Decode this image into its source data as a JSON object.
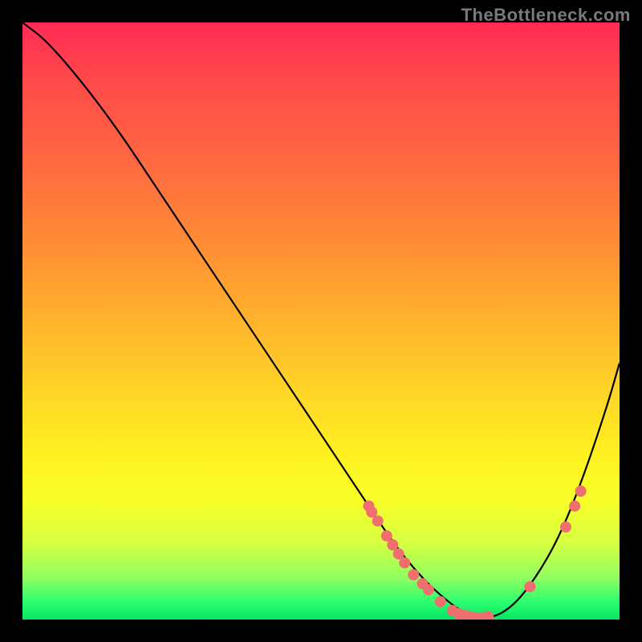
{
  "attribution": "TheBottleneck.com",
  "chart_data": {
    "type": "line",
    "title": "",
    "xlabel": "",
    "ylabel": "",
    "xlim": [
      0,
      100
    ],
    "ylim": [
      0,
      100
    ],
    "series": [
      {
        "name": "curve",
        "x": [
          0,
          4,
          10,
          16,
          22,
          28,
          34,
          40,
          46,
          52,
          58,
          62,
          66,
          70,
          74,
          78,
          82,
          86,
          90,
          94,
          98,
          100
        ],
        "y": [
          100,
          97,
          90,
          82,
          73,
          64,
          55,
          46,
          37,
          28,
          19,
          13,
          8,
          4,
          1,
          0,
          2,
          7,
          14,
          24,
          36,
          43
        ]
      }
    ],
    "scatter_points": [
      {
        "x": 58.0,
        "y": 19.0
      },
      {
        "x": 58.5,
        "y": 18.0
      },
      {
        "x": 59.5,
        "y": 16.5
      },
      {
        "x": 61.0,
        "y": 14.0
      },
      {
        "x": 62.0,
        "y": 12.5
      },
      {
        "x": 63.0,
        "y": 11.0
      },
      {
        "x": 64.0,
        "y": 9.5
      },
      {
        "x": 65.5,
        "y": 7.5
      },
      {
        "x": 67.0,
        "y": 6.0
      },
      {
        "x": 68.0,
        "y": 5.0
      },
      {
        "x": 70.0,
        "y": 3.0
      },
      {
        "x": 72.0,
        "y": 1.5
      },
      {
        "x": 73.0,
        "y": 1.0
      },
      {
        "x": 74.0,
        "y": 0.7
      },
      {
        "x": 75.0,
        "y": 0.5
      },
      {
        "x": 76.0,
        "y": 0.3
      },
      {
        "x": 77.0,
        "y": 0.3
      },
      {
        "x": 78.0,
        "y": 0.5
      },
      {
        "x": 85.0,
        "y": 5.5
      },
      {
        "x": 91.0,
        "y": 15.5
      },
      {
        "x": 92.5,
        "y": 19.0
      },
      {
        "x": 93.5,
        "y": 21.5
      }
    ],
    "colors": {
      "curve_stroke": "#000000",
      "point_fill": "#ef6f6f",
      "gradient_top": "#ff2a54",
      "gradient_bottom": "#06e564",
      "frame_bg": "#000000"
    }
  }
}
